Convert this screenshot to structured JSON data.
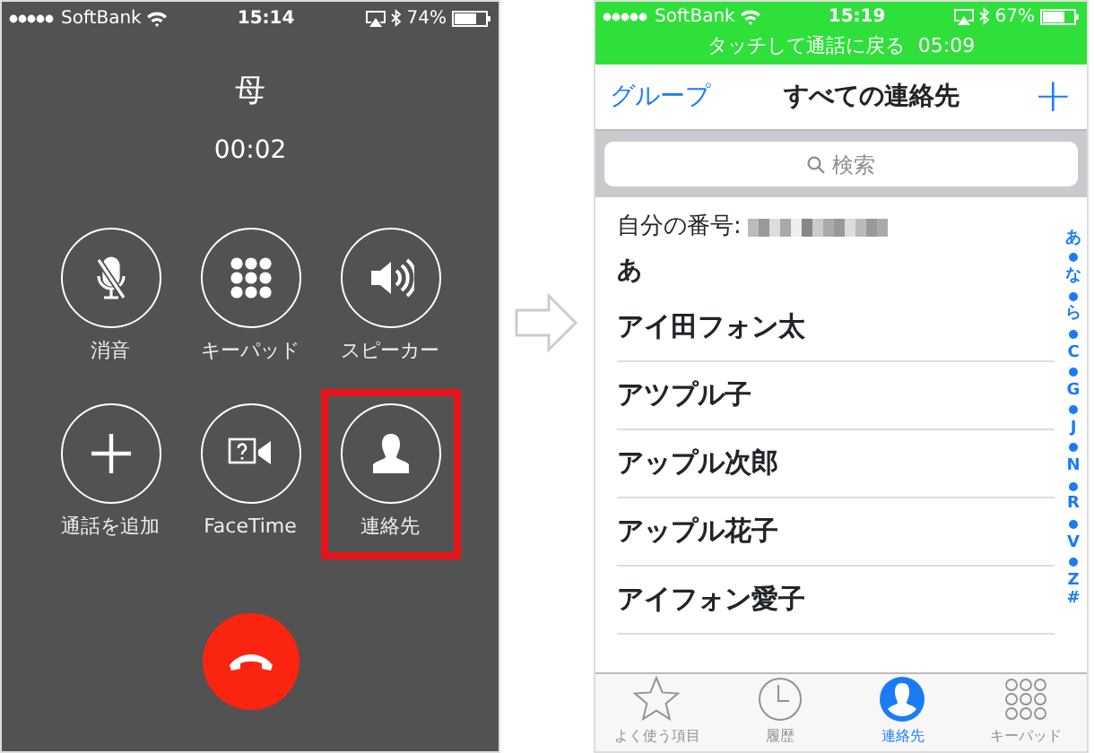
{
  "call_screen": {
    "status_bar": {
      "carrier": "SoftBank",
      "time": "15:14",
      "battery": "74%"
    },
    "caller": "母",
    "duration": "00:02",
    "buttons": [
      {
        "kind": "mute",
        "label": "消音",
        "highlighted": false
      },
      {
        "kind": "keypad",
        "label": "キーパッド",
        "highlighted": false
      },
      {
        "kind": "speaker",
        "label": "スピーカー",
        "highlighted": false
      },
      {
        "kind": "add",
        "label": "通話を追加",
        "highlighted": false
      },
      {
        "kind": "facetime",
        "label": "FaceTime",
        "highlighted": false
      },
      {
        "kind": "contacts",
        "label": "連絡先",
        "highlighted": true
      }
    ]
  },
  "contacts_screen": {
    "status_bar": {
      "carrier": "SoftBank",
      "time": "15:19",
      "battery": "67%"
    },
    "call_banner": {
      "text": "タッチして通話に戻る",
      "duration": "05:09"
    },
    "nav": {
      "left": "グループ",
      "title": "すべての連絡先",
      "right": "+"
    },
    "search": {
      "placeholder": "検索"
    },
    "my_number_label": "自分の番号:",
    "section": "あ",
    "contacts": [
      "アイ田フォン太",
      "アツプル子",
      "アップル次郎",
      "アップル花子",
      "アイフォン愛子"
    ],
    "index": [
      "あ",
      "な",
      "ら",
      "C",
      "G",
      "J",
      "N",
      "R",
      "V",
      "Z",
      "#"
    ],
    "tabs": [
      {
        "kind": "favorites",
        "label": "よく使う項目",
        "selected": false
      },
      {
        "kind": "recents",
        "label": "履歴",
        "selected": false
      },
      {
        "kind": "contacts",
        "label": "連絡先",
        "selected": true
      },
      {
        "kind": "keypad",
        "label": "キーパッド",
        "selected": false
      }
    ]
  }
}
